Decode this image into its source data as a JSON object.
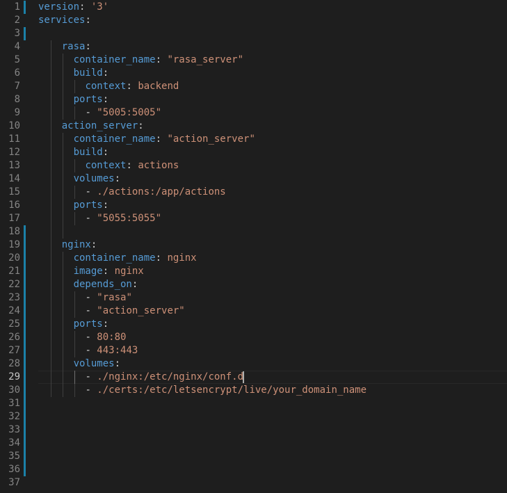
{
  "editor": {
    "language": "yaml",
    "active_line": 29,
    "colors": {
      "background": "#1e1e1e",
      "key": "#569cd6",
      "string": "#ce9178",
      "punctuation": "#d4d4d4",
      "line_number": "#858585",
      "modified_gutter": "#1b81a8",
      "indent_guide": "#404040"
    },
    "lines": [
      {
        "n": "1",
        "indent": 0,
        "dash": false,
        "key": "version",
        "sep": ": ",
        "val": "'3'"
      },
      {
        "n": "2",
        "indent": 0,
        "dash": false,
        "key": "services",
        "sep": ":",
        "val": ""
      },
      {
        "n": "3",
        "indent": 0,
        "dash": false,
        "key": "",
        "sep": "",
        "val": ""
      },
      {
        "n": "4",
        "indent": 2,
        "dash": false,
        "key": "rasa",
        "sep": ":",
        "val": ""
      },
      {
        "n": "5",
        "indent": 3,
        "dash": false,
        "key": "container_name",
        "sep": ": ",
        "val": "\"rasa_server\""
      },
      {
        "n": "6",
        "indent": 3,
        "dash": false,
        "key": "build",
        "sep": ":",
        "val": ""
      },
      {
        "n": "7",
        "indent": 4,
        "dash": false,
        "key": "context",
        "sep": ": ",
        "val": "backend"
      },
      {
        "n": "8",
        "indent": 3,
        "dash": false,
        "key": "ports",
        "sep": ":",
        "val": ""
      },
      {
        "n": "9",
        "indent": 4,
        "dash": true,
        "key": "",
        "sep": "",
        "val": "\"5005:5005\""
      },
      {
        "n": "10",
        "indent": 2,
        "dash": false,
        "key": "action_server",
        "sep": ":",
        "val": ""
      },
      {
        "n": "11",
        "indent": 3,
        "dash": false,
        "key": "container_name",
        "sep": ": ",
        "val": "\"action_server\""
      },
      {
        "n": "12",
        "indent": 3,
        "dash": false,
        "key": "build",
        "sep": ":",
        "val": ""
      },
      {
        "n": "13",
        "indent": 4,
        "dash": false,
        "key": "context",
        "sep": ": ",
        "val": "actions"
      },
      {
        "n": "14",
        "indent": 3,
        "dash": false,
        "key": "volumes",
        "sep": ":",
        "val": ""
      },
      {
        "n": "15",
        "indent": 4,
        "dash": true,
        "key": "",
        "sep": "",
        "val": "./actions:/app/actions"
      },
      {
        "n": "16",
        "indent": 3,
        "dash": false,
        "key": "ports",
        "sep": ":",
        "val": ""
      },
      {
        "n": "17",
        "indent": 4,
        "dash": true,
        "key": "",
        "sep": "",
        "val": "\"5055:5055\""
      },
      {
        "n": "18",
        "indent": 0,
        "dash": false,
        "key": "",
        "sep": "",
        "val": ""
      },
      {
        "n": "19",
        "indent": 2,
        "dash": false,
        "key": "nginx",
        "sep": ":",
        "val": ""
      },
      {
        "n": "20",
        "indent": 3,
        "dash": false,
        "key": "container_name",
        "sep": ": ",
        "val": "nginx"
      },
      {
        "n": "21",
        "indent": 3,
        "dash": false,
        "key": "image",
        "sep": ": ",
        "val": "nginx"
      },
      {
        "n": "22",
        "indent": 3,
        "dash": false,
        "key": "depends_on",
        "sep": ":",
        "val": ""
      },
      {
        "n": "23",
        "indent": 4,
        "dash": true,
        "key": "",
        "sep": "",
        "val": "\"rasa\""
      },
      {
        "n": "24",
        "indent": 4,
        "dash": true,
        "key": "",
        "sep": "",
        "val": "\"action_server\""
      },
      {
        "n": "25",
        "indent": 3,
        "dash": false,
        "key": "ports",
        "sep": ":",
        "val": ""
      },
      {
        "n": "26",
        "indent": 4,
        "dash": true,
        "key": "",
        "sep": "",
        "val": "80:80"
      },
      {
        "n": "27",
        "indent": 4,
        "dash": true,
        "key": "",
        "sep": "",
        "val": "443:443"
      },
      {
        "n": "28",
        "indent": 3,
        "dash": false,
        "key": "volumes",
        "sep": ":",
        "val": ""
      },
      {
        "n": "29",
        "indent": 4,
        "dash": true,
        "key": "",
        "sep": "",
        "val": "./nginx:/etc/nginx/conf.d"
      },
      {
        "n": "30",
        "indent": 4,
        "dash": true,
        "key": "",
        "sep": "",
        "val": "./certs:/etc/letsencrypt/live/your_domain_name"
      },
      {
        "n": "31",
        "indent": 0,
        "dash": false,
        "key": "",
        "sep": "",
        "val": ""
      },
      {
        "n": "32",
        "indent": 0,
        "dash": false,
        "key": "",
        "sep": "",
        "val": ""
      },
      {
        "n": "33",
        "indent": 0,
        "dash": false,
        "key": "",
        "sep": "",
        "val": ""
      },
      {
        "n": "34",
        "indent": 0,
        "dash": false,
        "key": "",
        "sep": "",
        "val": ""
      },
      {
        "n": "35",
        "indent": 0,
        "dash": false,
        "key": "",
        "sep": "",
        "val": ""
      },
      {
        "n": "36",
        "indent": 0,
        "dash": false,
        "key": "",
        "sep": "",
        "val": ""
      },
      {
        "n": "37",
        "indent": 0,
        "dash": false,
        "key": "",
        "sep": "",
        "val": ""
      }
    ]
  }
}
